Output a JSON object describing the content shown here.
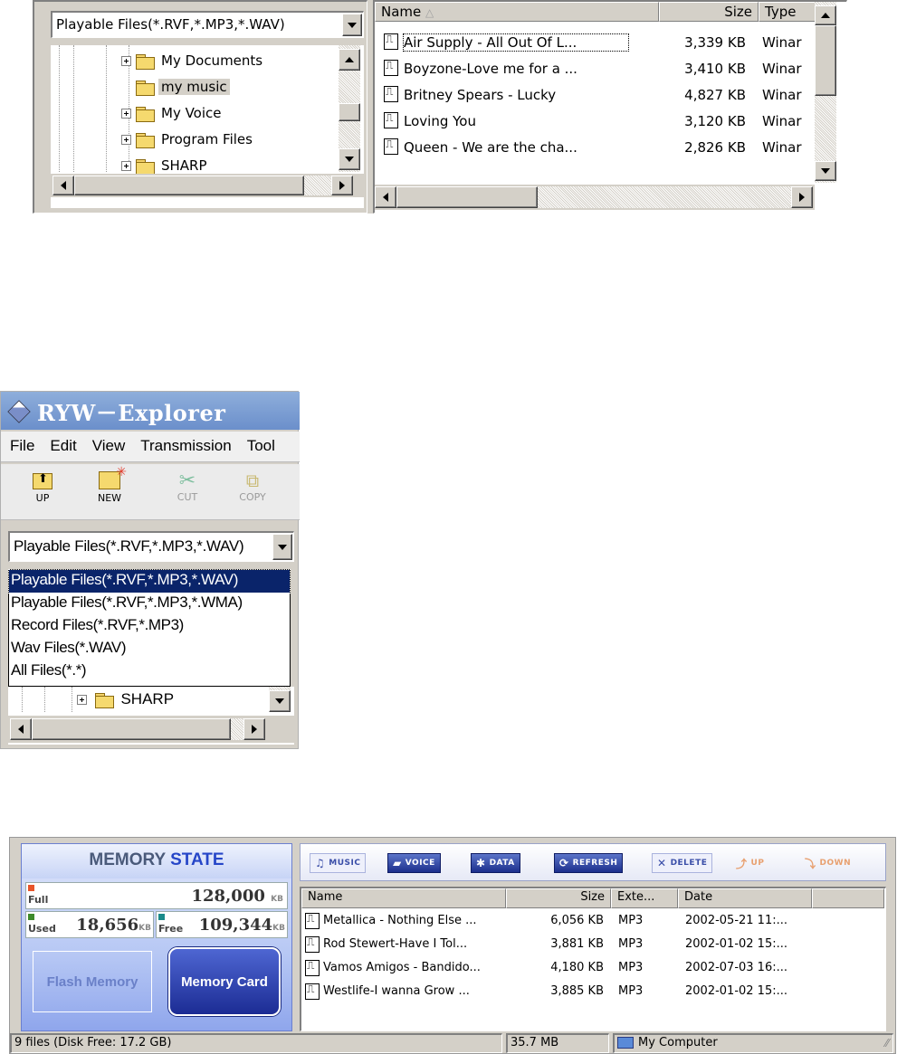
{
  "panel1": {
    "filter_value": "Playable Files(*.RVF,*.MP3,*.WAV)",
    "tree": [
      {
        "label": "My Documents",
        "expander": true,
        "selected": false
      },
      {
        "label": "my music",
        "expander": false,
        "selected": true
      },
      {
        "label": "My Voice",
        "expander": true,
        "selected": false
      },
      {
        "label": "Program Files",
        "expander": true,
        "selected": false
      },
      {
        "label": "SHARP",
        "expander": true,
        "selected": false
      }
    ],
    "columns": {
      "name": "Name",
      "size": "Size",
      "type": "Type"
    },
    "files": [
      {
        "name": "Air Supply - All Out Of L...",
        "size": "3,339 KB",
        "type": "Winar"
      },
      {
        "name": "Boyzone-Love me for a ...",
        "size": "3,410 KB",
        "type": "Winar"
      },
      {
        "name": "Britney Spears - Lucky",
        "size": "4,827 KB",
        "type": "Winar"
      },
      {
        "name": "Loving You",
        "size": "3,120 KB",
        "type": "Winar"
      },
      {
        "name": "Queen - We are the cha...",
        "size": "2,826 KB",
        "type": "Winar"
      }
    ]
  },
  "panel2": {
    "title": "RYW－Explorer",
    "menu": [
      "File",
      "Edit",
      "View",
      "Transmission",
      "Tool"
    ],
    "toolbar": {
      "up": "UP",
      "new": "NEW",
      "cut": "CUT",
      "copy": "COPY"
    },
    "filter_value": "Playable Files(*.RVF,*.MP3,*.WAV)",
    "options": [
      "Playable Files(*.RVF,*.MP3,*.WAV)",
      "Playable Files(*.RVF,*.MP3,*.WMA)",
      "Record Files(*.RVF,*.MP3)",
      "Wav Files(*.WAV)",
      "All Files(*.*)"
    ],
    "tree_item": "SHARP"
  },
  "panel3": {
    "memory": {
      "title_a": "MEMORY",
      "title_b": "STATE",
      "full_label": "Full",
      "full_value": "128,000",
      "used_label": "Used",
      "used_value": "18,656",
      "free_label": "Free",
      "free_value": "109,344",
      "unit": "KB",
      "flash_label": "Flash Memory",
      "card_label": "Memory Card",
      "colors": {
        "full": "#e8542a",
        "used": "#3e8a2a",
        "free": "#1a8a8a"
      }
    },
    "toolbar": {
      "music": "MUSIC",
      "voice": "VOICE",
      "data": "DATA",
      "refresh": "REFRESH",
      "delete": "DELETE",
      "up": "UP",
      "down": "DOWN"
    },
    "columns": {
      "name": "Name",
      "size": "Size",
      "ext": "Exte...",
      "date": "Date"
    },
    "files": [
      {
        "name": "Metallica - Nothing Else ...",
        "size": "6,056 KB",
        "ext": "MP3",
        "date": "2002-05-21 11:..."
      },
      {
        "name": "Rod Stewert-Have I Tol...",
        "size": "3,881 KB",
        "ext": "MP3",
        "date": "2002-01-02 15:..."
      },
      {
        "name": "Vamos Amigos - Bandido...",
        "size": "4,180 KB",
        "ext": "MP3",
        "date": "2002-07-03 16:..."
      },
      {
        "name": "Westlife-I wanna Grow ...",
        "size": "3,885 KB",
        "ext": "MP3",
        "date": "2002-01-02 15:..."
      }
    ],
    "status": {
      "files": "9 files (Disk Free: 17.2 GB)",
      "size": "35.7 MB",
      "location": "My Computer"
    }
  }
}
